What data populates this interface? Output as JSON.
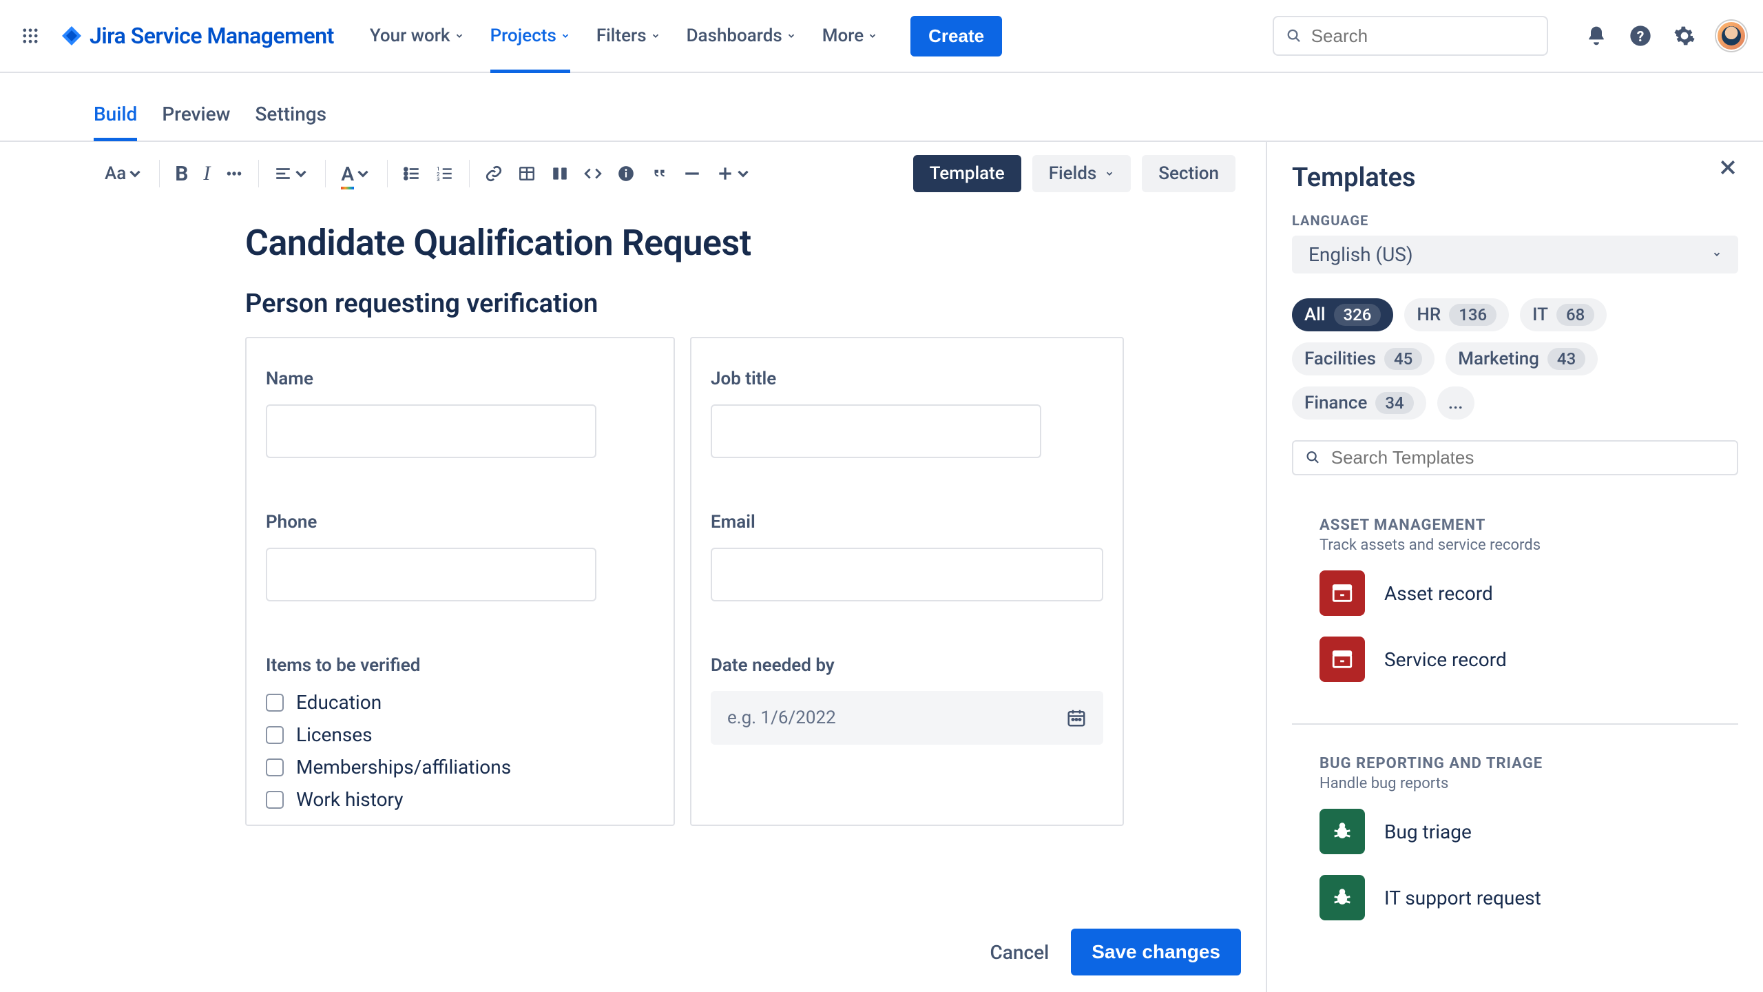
{
  "brand": "Jira Service Management",
  "nav": {
    "items": [
      "Your work",
      "Projects",
      "Filters",
      "Dashboards",
      "More"
    ],
    "active_index": 1,
    "create": "Create",
    "search_placeholder": "Search"
  },
  "subnav": {
    "tabs": [
      "Build",
      "Preview",
      "Settings"
    ],
    "active_index": 0
  },
  "toolbar": {
    "text_style": "Aa",
    "template": "Template",
    "fields": "Fields",
    "section": "Section"
  },
  "doc": {
    "title": "Candidate Qualification Request",
    "subtitle": "Person requesting verification",
    "left": {
      "name_label": "Name",
      "phone_label": "Phone",
      "items_label": "Items to be verified",
      "items": [
        "Education",
        "Licenses",
        "Memberships/affiliations",
        "Work history"
      ]
    },
    "right": {
      "jobtitle_label": "Job title",
      "email_label": "Email",
      "date_label": "Date needed by",
      "date_placeholder": "e.g. 1/6/2022"
    }
  },
  "footer": {
    "cancel": "Cancel",
    "save": "Save changes"
  },
  "side": {
    "title": "Templates",
    "language_label": "LANGUAGE",
    "language_value": "English (US)",
    "chips": [
      {
        "label": "All",
        "count": "326",
        "active": true
      },
      {
        "label": "HR",
        "count": "136"
      },
      {
        "label": "IT",
        "count": "68"
      },
      {
        "label": "Facilities",
        "count": "45"
      },
      {
        "label": "Marketing",
        "count": "43"
      },
      {
        "label": "Finance",
        "count": "34"
      }
    ],
    "more": "...",
    "search_placeholder": "Search Templates",
    "sections": [
      {
        "title": "ASSET MANAGEMENT",
        "desc": "Track assets and service records",
        "items": [
          {
            "label": "Asset record",
            "color": "red",
            "icon": "box"
          },
          {
            "label": "Service record",
            "color": "red",
            "icon": "box"
          }
        ]
      },
      {
        "title": "BUG REPORTING AND TRIAGE",
        "desc": "Handle bug reports",
        "items": [
          {
            "label": "Bug triage",
            "color": "green",
            "icon": "bug"
          },
          {
            "label": "IT support request",
            "color": "green",
            "icon": "bug"
          }
        ]
      }
    ]
  }
}
